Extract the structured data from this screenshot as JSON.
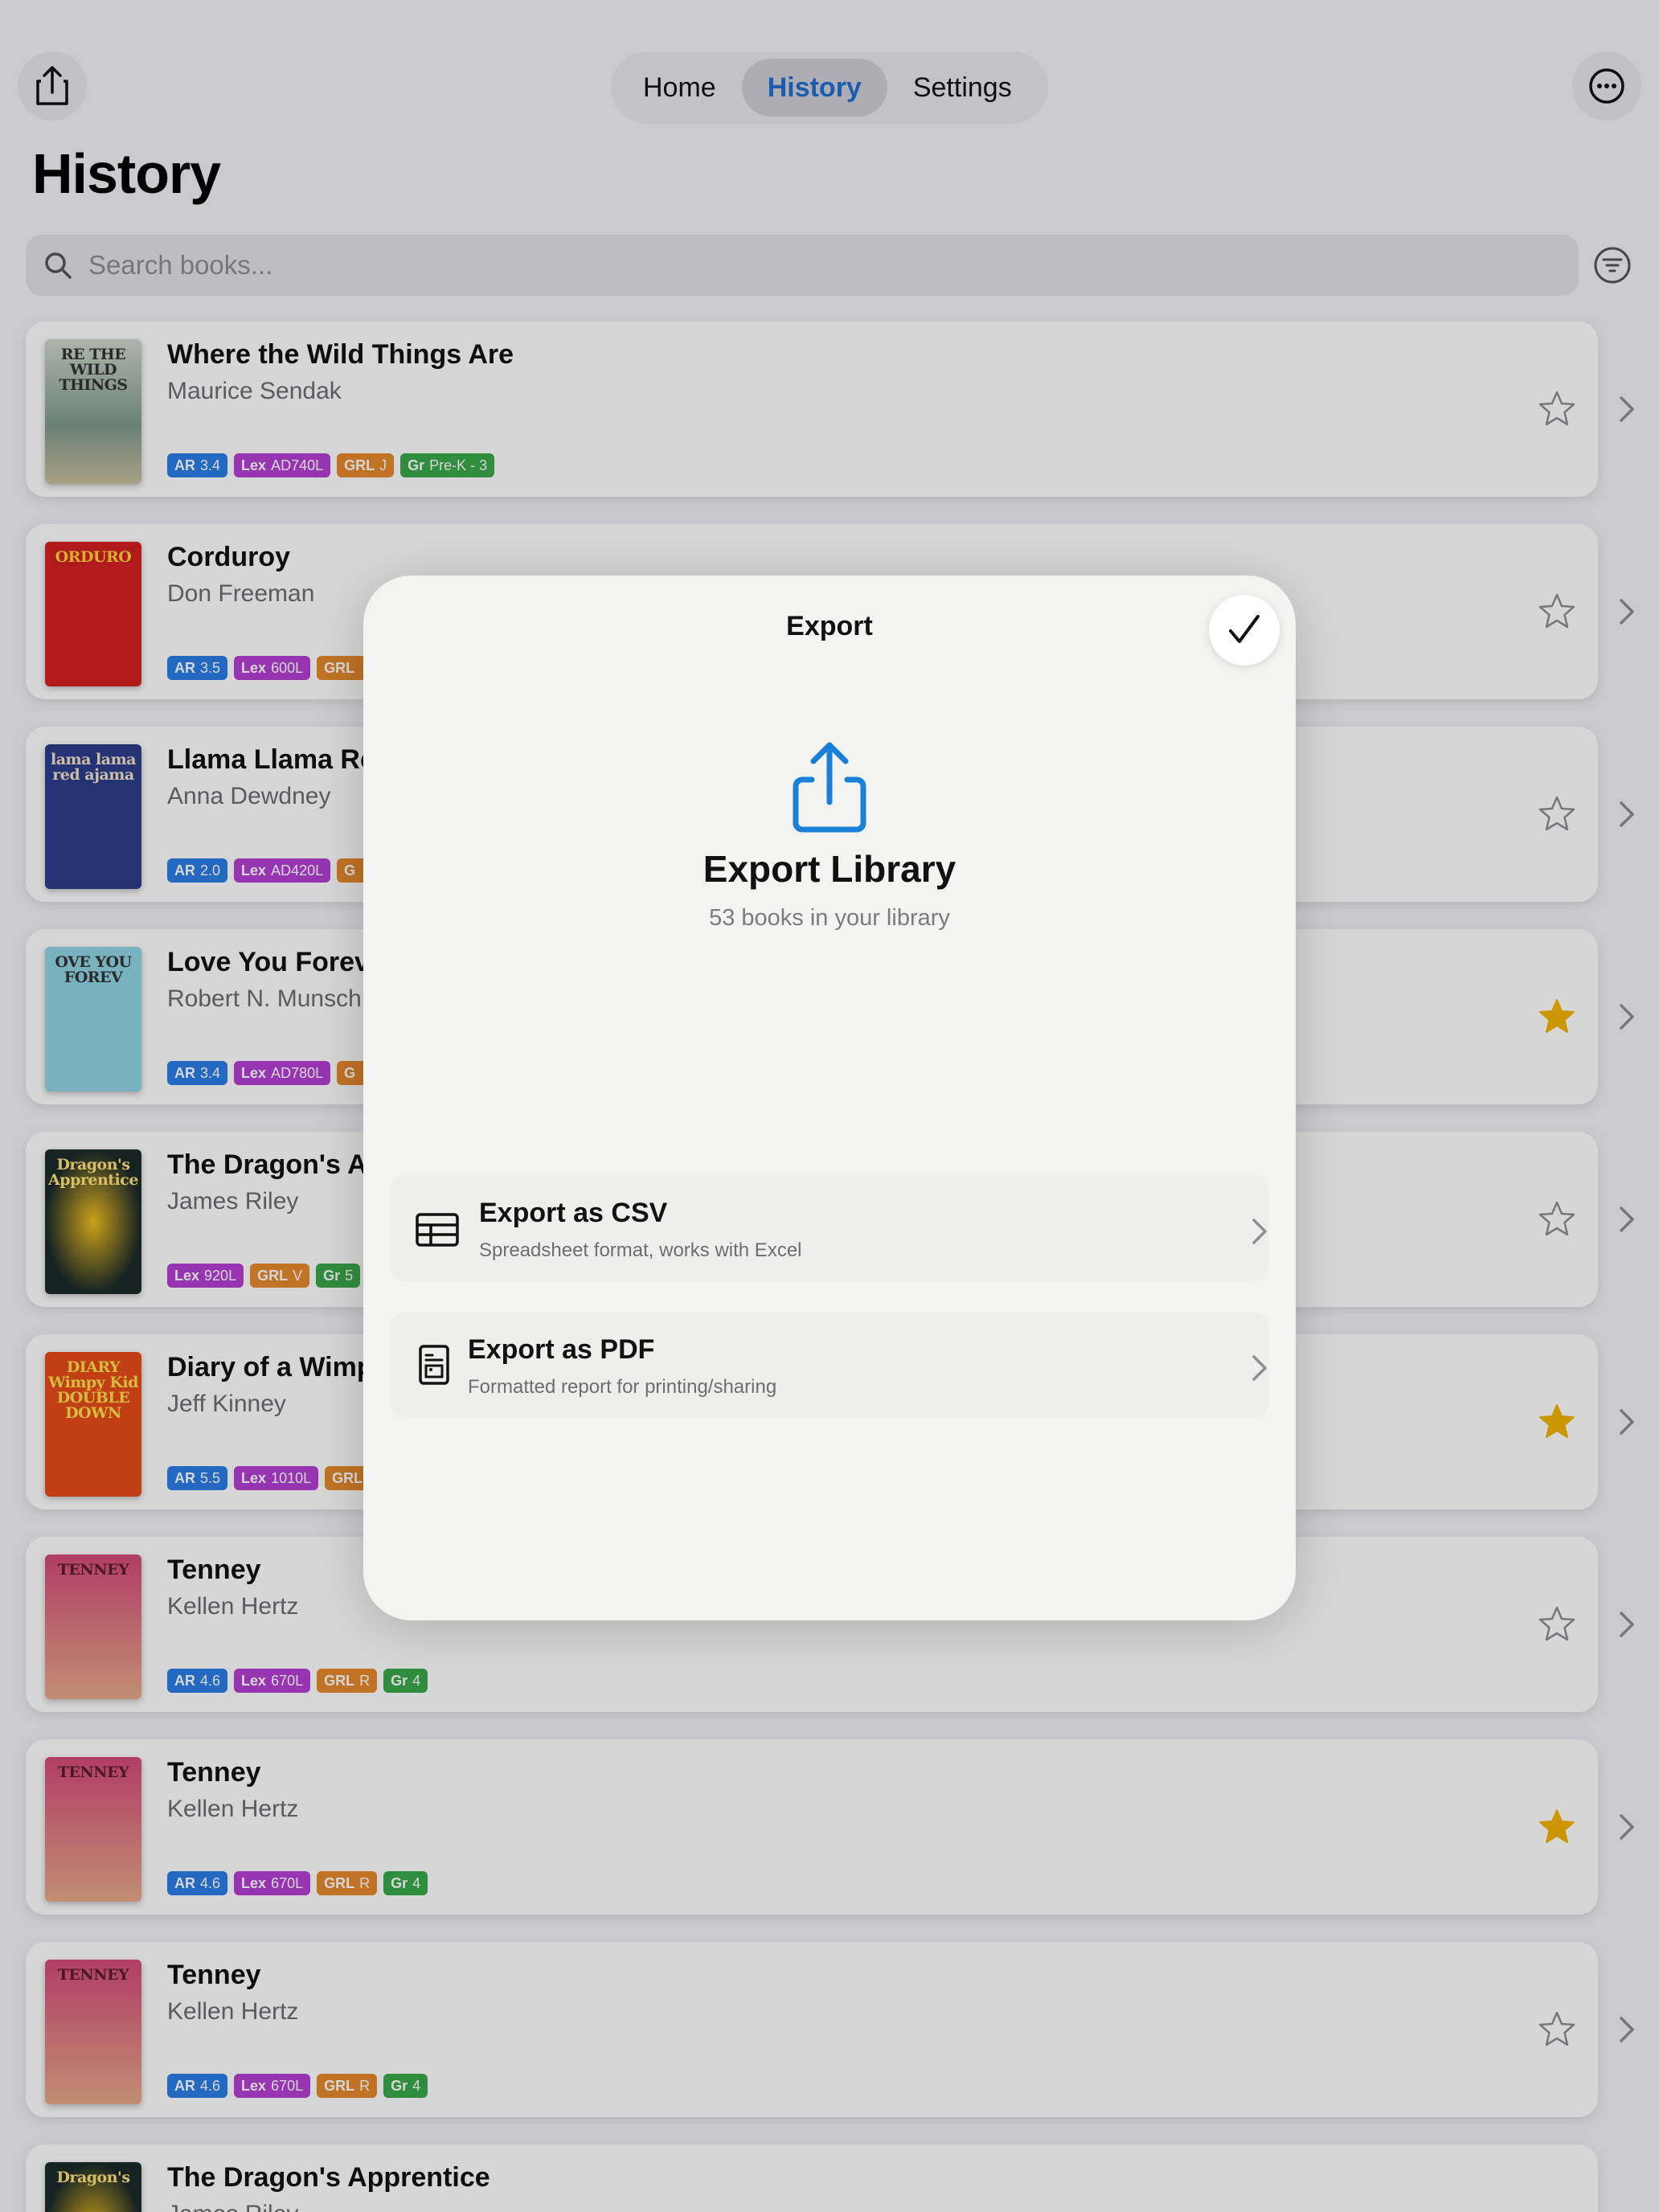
{
  "nav": {
    "tabs": [
      {
        "label": "Home"
      },
      {
        "label": "History"
      },
      {
        "label": "Settings"
      }
    ],
    "active_tab": "History",
    "share_icon": "share-icon",
    "more_icon": "ellipsis-circle-icon"
  },
  "page": {
    "title": "History",
    "search_placeholder": "Search books...",
    "filter_icon": "filter-icon"
  },
  "books": [
    {
      "title": "Where the Wild Things Are",
      "author": "Maurice Sendak",
      "cover_text": "RE THE WILD THINGS",
      "favorite": false,
      "badges": [
        {
          "kind": "AR",
          "value": "3.4"
        },
        {
          "kind": "Lex",
          "value": "AD740L"
        },
        {
          "kind": "GRL",
          "value": "J"
        },
        {
          "kind": "Gr",
          "value": "Pre-K - 3"
        }
      ]
    },
    {
      "title": "Corduroy",
      "author": "Don Freeman",
      "cover_text": "ORDURO",
      "favorite": false,
      "badges": [
        {
          "kind": "AR",
          "value": "3.5"
        },
        {
          "kind": "Lex",
          "value": "600L"
        },
        {
          "kind": "GRL",
          "value": ""
        }
      ]
    },
    {
      "title": "Llama Llama Re",
      "author": "Anna Dewdney",
      "cover_text": "lama lama red ajama",
      "favorite": false,
      "badges": [
        {
          "kind": "AR",
          "value": "2.0"
        },
        {
          "kind": "Lex",
          "value": "AD420L"
        },
        {
          "kind": "G",
          "value": ""
        }
      ]
    },
    {
      "title": "Love You Foreve",
      "author": "Robert N. Munsch",
      "cover_text": "OVE YOU FOREV",
      "favorite": true,
      "badges": [
        {
          "kind": "AR",
          "value": "3.4"
        },
        {
          "kind": "Lex",
          "value": "AD780L"
        },
        {
          "kind": "G",
          "value": ""
        }
      ]
    },
    {
      "title": "The Dragon's A",
      "author": "James Riley",
      "cover_text": "Dragon's Apprentice",
      "favorite": false,
      "badges": [
        {
          "kind": "Lex",
          "value": "920L"
        },
        {
          "kind": "GRL",
          "value": "V"
        },
        {
          "kind": "Gr",
          "value": "5"
        }
      ]
    },
    {
      "title": "Diary of a Wimp",
      "author": "Jeff Kinney",
      "cover_text": "DIARY Wimpy Kid DOUBLE DOWN",
      "favorite": true,
      "badges": [
        {
          "kind": "AR",
          "value": "5.5"
        },
        {
          "kind": "Lex",
          "value": "1010L"
        },
        {
          "kind": "GRL",
          "value": ""
        }
      ]
    },
    {
      "title": "Tenney",
      "author": "Kellen Hertz",
      "cover_text": "TENNEY",
      "favorite": false,
      "badges": [
        {
          "kind": "AR",
          "value": "4.6"
        },
        {
          "kind": "Lex",
          "value": "670L"
        },
        {
          "kind": "GRL",
          "value": "R"
        },
        {
          "kind": "Gr",
          "value": "4"
        }
      ]
    },
    {
      "title": "Tenney",
      "author": "Kellen Hertz",
      "cover_text": "TENNEY",
      "favorite": true,
      "badges": [
        {
          "kind": "AR",
          "value": "4.6"
        },
        {
          "kind": "Lex",
          "value": "670L"
        },
        {
          "kind": "GRL",
          "value": "R"
        },
        {
          "kind": "Gr",
          "value": "4"
        }
      ]
    },
    {
      "title": "Tenney",
      "author": "Kellen Hertz",
      "cover_text": "TENNEY",
      "favorite": false,
      "badges": [
        {
          "kind": "AR",
          "value": "4.6"
        },
        {
          "kind": "Lex",
          "value": "670L"
        },
        {
          "kind": "GRL",
          "value": "R"
        },
        {
          "kind": "Gr",
          "value": "4"
        }
      ]
    },
    {
      "title": "The Dragon's Apprentice",
      "author": "James Riley",
      "cover_text": "Dragon's",
      "favorite": false,
      "badges": []
    }
  ],
  "modal": {
    "title": "Export",
    "done_icon": "checkmark-icon",
    "hero_icon": "share-icon",
    "hero_title": "Export Library",
    "hero_subtitle": "53 books in your library",
    "options": [
      {
        "title": "Export as CSV",
        "description": "Spreadsheet format, works with Excel",
        "icon": "table-icon"
      },
      {
        "title": "Export as PDF",
        "description": "Formatted report for printing/sharing",
        "icon": "document-icon"
      }
    ]
  },
  "colors": {
    "accent": "#1f6fd1",
    "export_icon": "#1a7fd6",
    "badge_ar": "#2c7ee6",
    "badge_lex": "#b33fd4",
    "badge_grl": "#e58a2c",
    "badge_gr": "#3aa84a",
    "star_filled": "#f2b300"
  }
}
